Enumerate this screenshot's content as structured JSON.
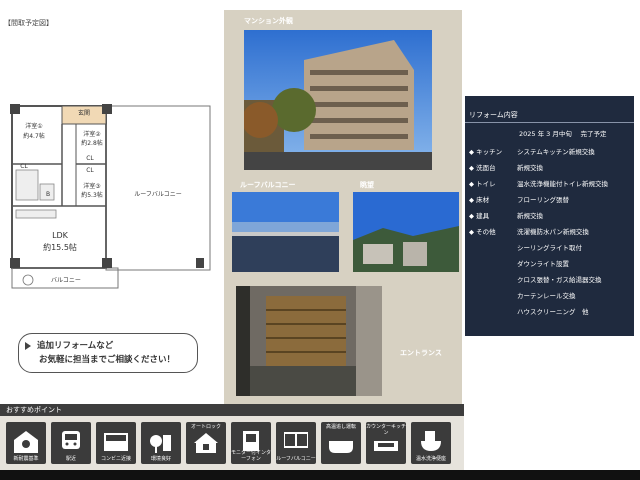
{
  "floorplan": {
    "title": "【間取予定図】",
    "rooms": {
      "western1": "洋室①",
      "western1_size": "約4.7帖",
      "western2": "洋室②",
      "western2_size": "約2.8帖",
      "western3": "洋室③",
      "western3_size": "約5.3帖",
      "entrance": "玄関",
      "ldk": "LDK",
      "ldk_size": "約15.5帖",
      "roof_balcony": "ルーフバルコニー",
      "balcony": "バルコニー",
      "cl1": "CL",
      "cl2": "CL",
      "cl3": "CL",
      "bath": "B"
    }
  },
  "speech": {
    "line1": "追加リフォームなど",
    "line2": "お気軽に担当までご相談ください！"
  },
  "photos": {
    "mansion": "マンション外観",
    "roof": "ルーフバルコニー",
    "view": "眺望",
    "entrance": "エントランス"
  },
  "reform": {
    "header": "リフォーム内容",
    "date": "2025 年 3 月中旬　 完了予定",
    "items": [
      {
        "cat": "◆ キッチン",
        "desc": "システムキッチン新規交換"
      },
      {
        "cat": "◆ 洗面台",
        "desc": "新規交換"
      },
      {
        "cat": "◆ トイレ",
        "desc": "温水洗浄機能付トイレ新規交換"
      },
      {
        "cat": "◆ 床材",
        "desc": "フローリング張替"
      },
      {
        "cat": "◆ 建具",
        "desc": "新規交換"
      },
      {
        "cat": "◆ その他",
        "desc": "洗濯機防水パン新規交換"
      },
      {
        "cat": "",
        "desc": "シーリングライト取付"
      },
      {
        "cat": "",
        "desc": "ダウンライト設置"
      },
      {
        "cat": "",
        "desc": "クロス張替・ガス給湯器交換"
      },
      {
        "cat": "",
        "desc": "カーテンレール交換"
      },
      {
        "cat": "",
        "desc": "ハウスクリーニング　他"
      }
    ]
  },
  "recommend": {
    "title": "おすすめポイント",
    "icons": [
      {
        "name": "new-seismic-icon",
        "top": "",
        "cap": "新耐震基準"
      },
      {
        "name": "station-icon",
        "top": "",
        "cap": "駅近"
      },
      {
        "name": "convenience-store-icon",
        "top": "",
        "cap": "コンビニ近接"
      },
      {
        "name": "environment-icon",
        "top": "",
        "cap": "環境良好"
      },
      {
        "name": "autolock-icon",
        "top": "オートロック",
        "cap": ""
      },
      {
        "name": "monitor-intercom-icon",
        "top": "",
        "cap": "モニター付インターフォン"
      },
      {
        "name": "roof-balcony-icon",
        "top": "",
        "cap": "ルーフバルコニー"
      },
      {
        "name": "reheat-bath-icon",
        "top": "高温追し運転",
        "cap": ""
      },
      {
        "name": "counter-kitchen-icon",
        "top": "カウンターキッチン",
        "cap": ""
      },
      {
        "name": "washlet-icon",
        "top": "",
        "cap": "温水洗浄便座"
      }
    ]
  },
  "colors": {
    "beige_panel": "#d7d1c2",
    "reform_panel": "#1f2a3e",
    "icon_bg": "#3b3b3b"
  }
}
